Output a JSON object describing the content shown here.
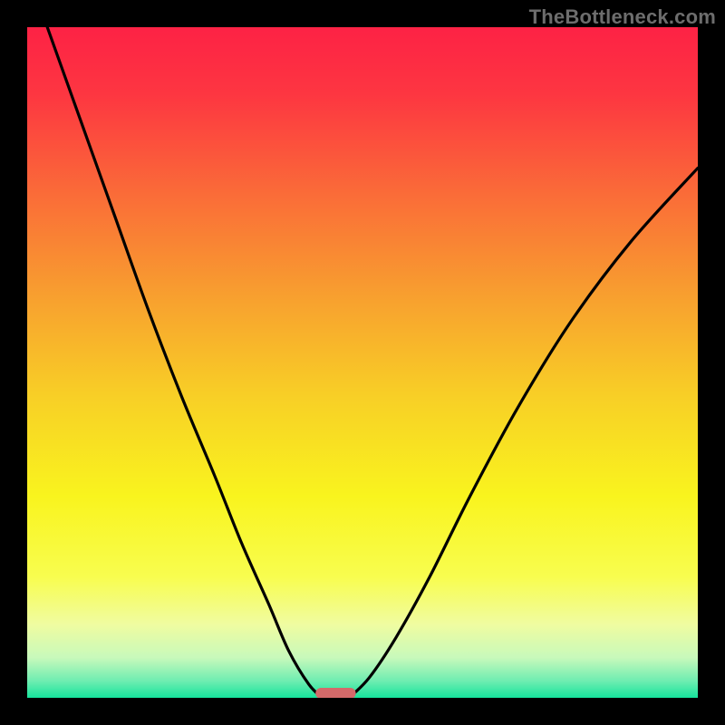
{
  "watermark": {
    "text": "TheBottleneck.com"
  },
  "chart_data": {
    "type": "line",
    "title": "",
    "xlabel": "",
    "ylabel": "",
    "xlim": [
      0,
      100
    ],
    "ylim": [
      0,
      100
    ],
    "grid": false,
    "legend": false,
    "series": [
      {
        "name": "curve-left",
        "x": [
          3,
          8,
          13,
          18,
          23,
          28,
          32,
          36,
          39,
          42,
          44
        ],
        "y": [
          100,
          86,
          72,
          58,
          45,
          33,
          23,
          14,
          7,
          2,
          0
        ]
      },
      {
        "name": "curve-right",
        "x": [
          48,
          51,
          55,
          60,
          66,
          73,
          81,
          90,
          100
        ],
        "y": [
          0,
          3,
          9,
          18,
          30,
          43,
          56,
          68,
          79
        ]
      }
    ],
    "marker": {
      "name": "min-marker",
      "x_center": 46,
      "y": 0,
      "color": "#d46a6a",
      "width_pct": 6
    },
    "gradient_stops": [
      {
        "offset": 0.0,
        "color": "#fd2245"
      },
      {
        "offset": 0.1,
        "color": "#fd3641"
      },
      {
        "offset": 0.25,
        "color": "#fa6c38"
      },
      {
        "offset": 0.4,
        "color": "#f89f2f"
      },
      {
        "offset": 0.55,
        "color": "#f8cf26"
      },
      {
        "offset": 0.7,
        "color": "#f9f41e"
      },
      {
        "offset": 0.82,
        "color": "#f8fd4f"
      },
      {
        "offset": 0.89,
        "color": "#f0fca0"
      },
      {
        "offset": 0.94,
        "color": "#c8f9bb"
      },
      {
        "offset": 0.975,
        "color": "#6eedb1"
      },
      {
        "offset": 1.0,
        "color": "#16e49c"
      }
    ]
  }
}
